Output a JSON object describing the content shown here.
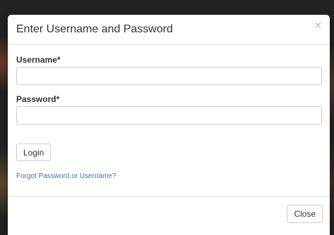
{
  "modal": {
    "title": "Enter Username and Password",
    "close_icon": "×",
    "fields": {
      "username": {
        "label": "Username*",
        "value": "",
        "placeholder": ""
      },
      "password": {
        "label": "Password*",
        "value": "",
        "placeholder": ""
      }
    },
    "login_label": "Login",
    "forgot_link": "Forgot Password or Username?",
    "close_label": "Close"
  },
  "colors": {
    "link": "#337ab7",
    "text": "#333333",
    "border": "#cccccc",
    "divider": "#e5e5e5",
    "backdrop": "#222222"
  },
  "icons": {
    "close": "close-icon"
  }
}
